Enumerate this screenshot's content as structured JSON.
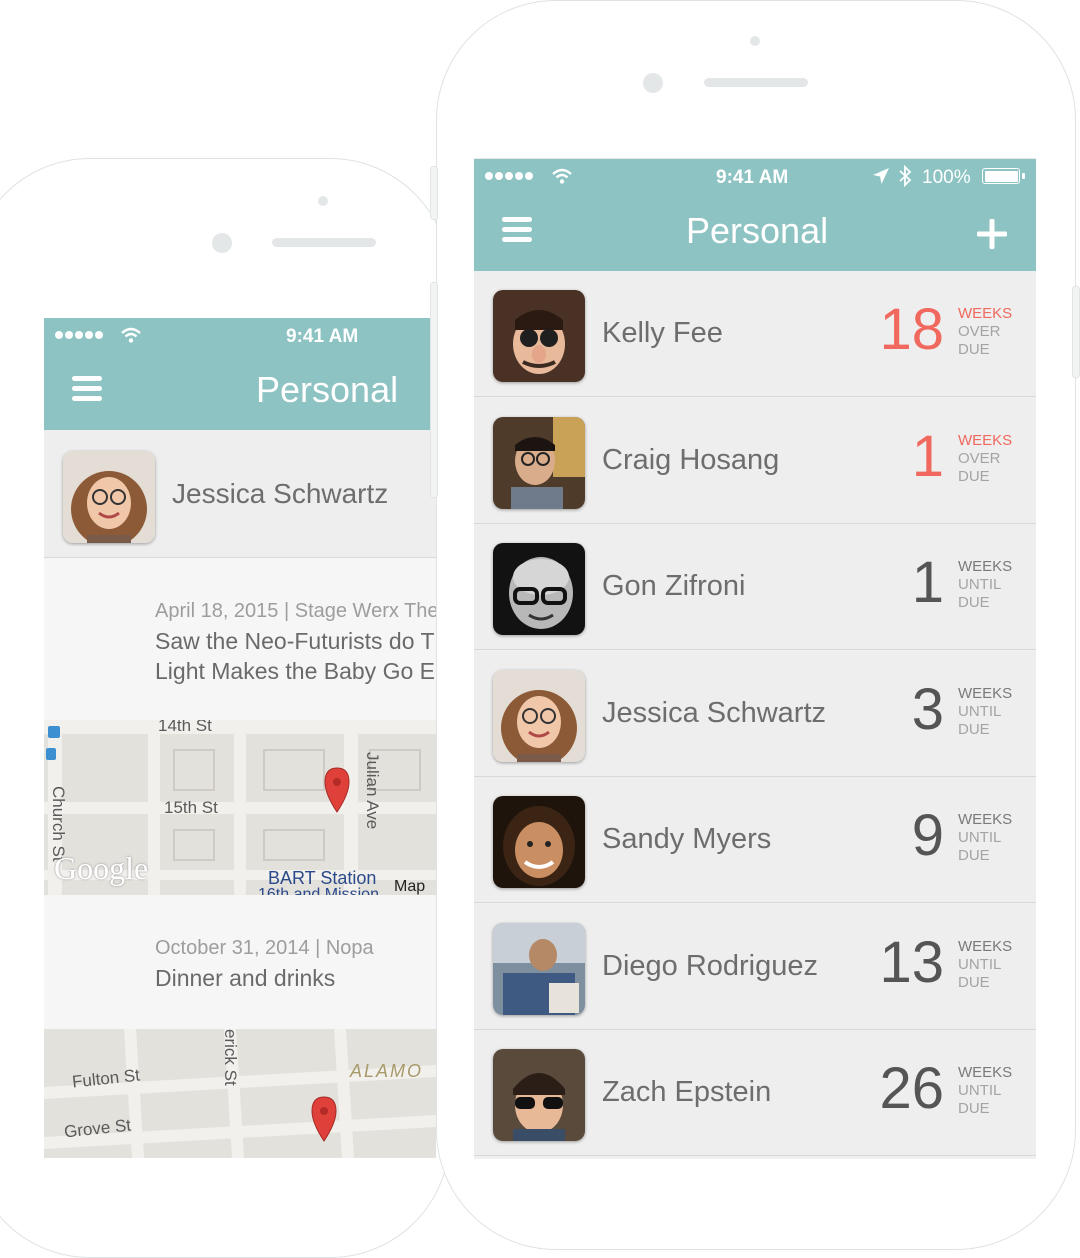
{
  "colors": {
    "nav": "#8dc3c2",
    "overdue": "#f0685e",
    "ontime": "#555555"
  },
  "back_phone": {
    "status_time": "9:41 AM",
    "nav_title": "Personal",
    "menu_icon": "hamburger-menu-icon",
    "contact_name": "Jessica Schwartz",
    "entries": [
      {
        "date": "April 18, 2015 | Stage Werx The",
        "desc1": "Saw the Neo-Futurists do T",
        "desc2": "Light Makes the Baby Go E"
      },
      {
        "date": "October 31, 2014 | Nopa",
        "desc1": "Dinner and drinks"
      }
    ],
    "map1": {
      "street_a": "14th St",
      "street_b": "15th St",
      "street_c": "Church St",
      "street_d": "Julian Ave",
      "place": "BART Station",
      "place2": "16th and Mission",
      "brand": "Google",
      "map_link": "Map"
    },
    "map2": {
      "street_a": "Fulton St",
      "street_b": "Grove St",
      "street_c": "erick St",
      "district": "ALAMO"
    }
  },
  "front_phone": {
    "status_time": "9:41 AM",
    "battery": "100%",
    "nav_title": "Personal",
    "menu_icon": "hamburger-menu-icon",
    "add_icon": "plus-icon",
    "contacts": [
      {
        "name": "Kelly Fee",
        "count": "18",
        "u1": "WEEKS",
        "u2": "OVER",
        "u3": "DUE",
        "state": "overdue"
      },
      {
        "name": "Craig Hosang",
        "count": "1",
        "u1": "WEEKS",
        "u2": "OVER",
        "u3": "DUE",
        "state": "overdue"
      },
      {
        "name": "Gon Zifroni",
        "count": "1",
        "u1": "WEEKS",
        "u2": "UNTIL",
        "u3": "DUE",
        "state": "ontime"
      },
      {
        "name": "Jessica Schwartz",
        "count": "3",
        "u1": "WEEKS",
        "u2": "UNTIL",
        "u3": "DUE",
        "state": "ontime"
      },
      {
        "name": "Sandy Myers",
        "count": "9",
        "u1": "WEEKS",
        "u2": "UNTIL",
        "u3": "DUE",
        "state": "ontime"
      },
      {
        "name": "Diego Rodriguez",
        "count": "13",
        "u1": "WEEKS",
        "u2": "UNTIL",
        "u3": "DUE",
        "state": "ontime"
      },
      {
        "name": "Zach Epstein",
        "count": "26",
        "u1": "WEEKS",
        "u2": "UNTIL",
        "u3": "DUE",
        "state": "ontime"
      }
    ]
  }
}
